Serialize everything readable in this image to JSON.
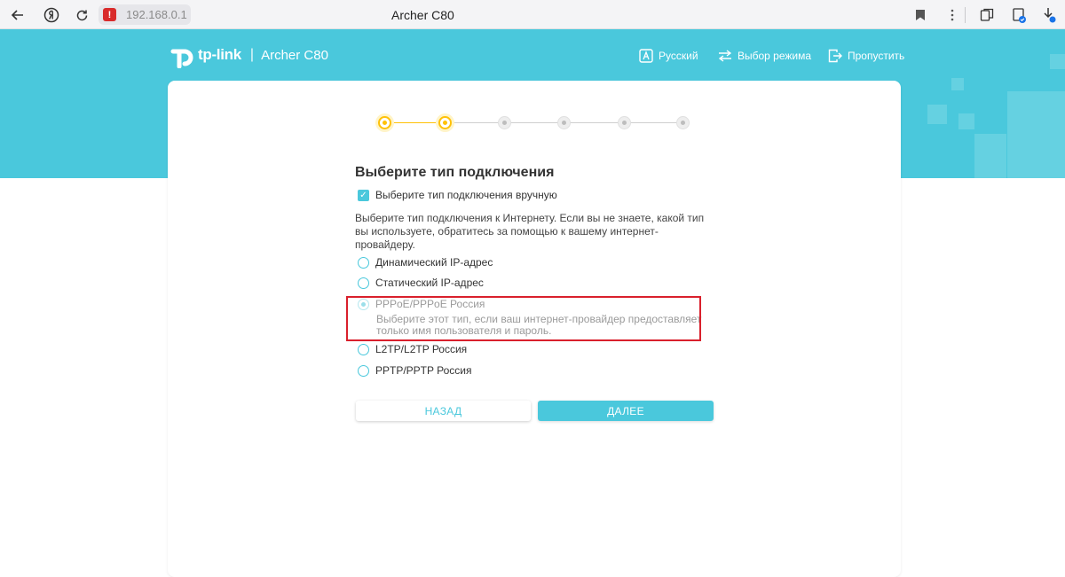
{
  "browser": {
    "url": "192.168.0.1",
    "tab_title": "Archer C80",
    "warning_glyph": "!",
    "icons": [
      "back-arrow-icon",
      "yandex-icon",
      "reload-icon",
      "security-warning-icon",
      "bookmark-icon",
      "more-icon",
      "collections-icon",
      "extension-icon",
      "downloads-icon"
    ]
  },
  "header": {
    "brand": "tp-link",
    "model": "Archer C80",
    "nav": [
      {
        "label": "Русский",
        "icon": "language-icon"
      },
      {
        "label": "Выбор режима",
        "icon": "mode-switch-icon"
      },
      {
        "label": "Пропустить",
        "icon": "exit-icon"
      }
    ],
    "accent_color": "#4ac8dc"
  },
  "stepper": {
    "total_steps": 6,
    "completed_steps": 2,
    "active_color": "#ffc107"
  },
  "form": {
    "title": "Выберите тип подключения",
    "manual_checkbox_label": "Выберите тип подключения вручную",
    "manual_checked": true,
    "description": "Выберите тип подключения к Интернету. Если вы не знаете, какой тип вы используете, обратитесь за помощью к вашему интернет-провайдеру.",
    "options": [
      {
        "label": "Динамический IP-адрес",
        "selected": false
      },
      {
        "label": "Статический IP-адрес",
        "selected": false
      },
      {
        "label": "PPPoE/PPPoE Россия",
        "selected": true,
        "hint": "Выберите этот тип, если ваш интернет-провайдер предоставляет только имя пользователя и пароль."
      },
      {
        "label": "L2TP/L2TP Россия",
        "selected": false
      },
      {
        "label": "PPTP/PPTP Россия",
        "selected": false
      }
    ],
    "back_button": "НАЗАД",
    "next_button": "ДАЛЕЕ",
    "highlight_color": "#d9202c"
  }
}
